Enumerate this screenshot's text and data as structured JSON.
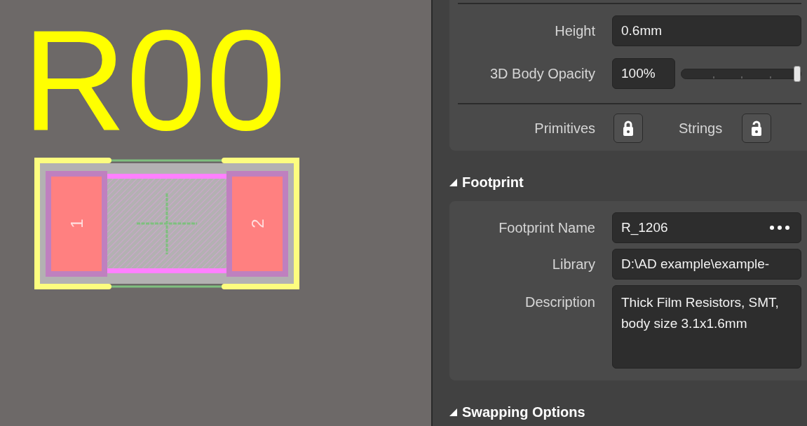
{
  "canvas": {
    "designator": "R00",
    "pads": [
      {
        "number": "1"
      },
      {
        "number": "2"
      }
    ]
  },
  "properties": {
    "rows": [
      {
        "label": "Height",
        "kind": "field",
        "value": "0.6mm"
      },
      {
        "label": "3D Body Opacity",
        "kind": "slider",
        "value": "100%",
        "level": 1
      }
    ],
    "locks": [
      {
        "label": "Primitives",
        "locked": true
      },
      {
        "label": "Strings",
        "locked": false
      }
    ]
  },
  "sections": [
    {
      "title": "Footprint",
      "expanded": true,
      "fields": [
        {
          "label": "Footprint Name",
          "kind": "browse",
          "value": "R_1206"
        },
        {
          "label": "Library",
          "kind": "field",
          "value": "D:\\AD example\\example-"
        },
        {
          "label": "Description",
          "kind": "multiline",
          "value": "Thick Film Resistors, SMT, body size 3.1x1.6mm"
        }
      ]
    },
    {
      "title": "Swapping Options",
      "expanded": true
    }
  ]
}
